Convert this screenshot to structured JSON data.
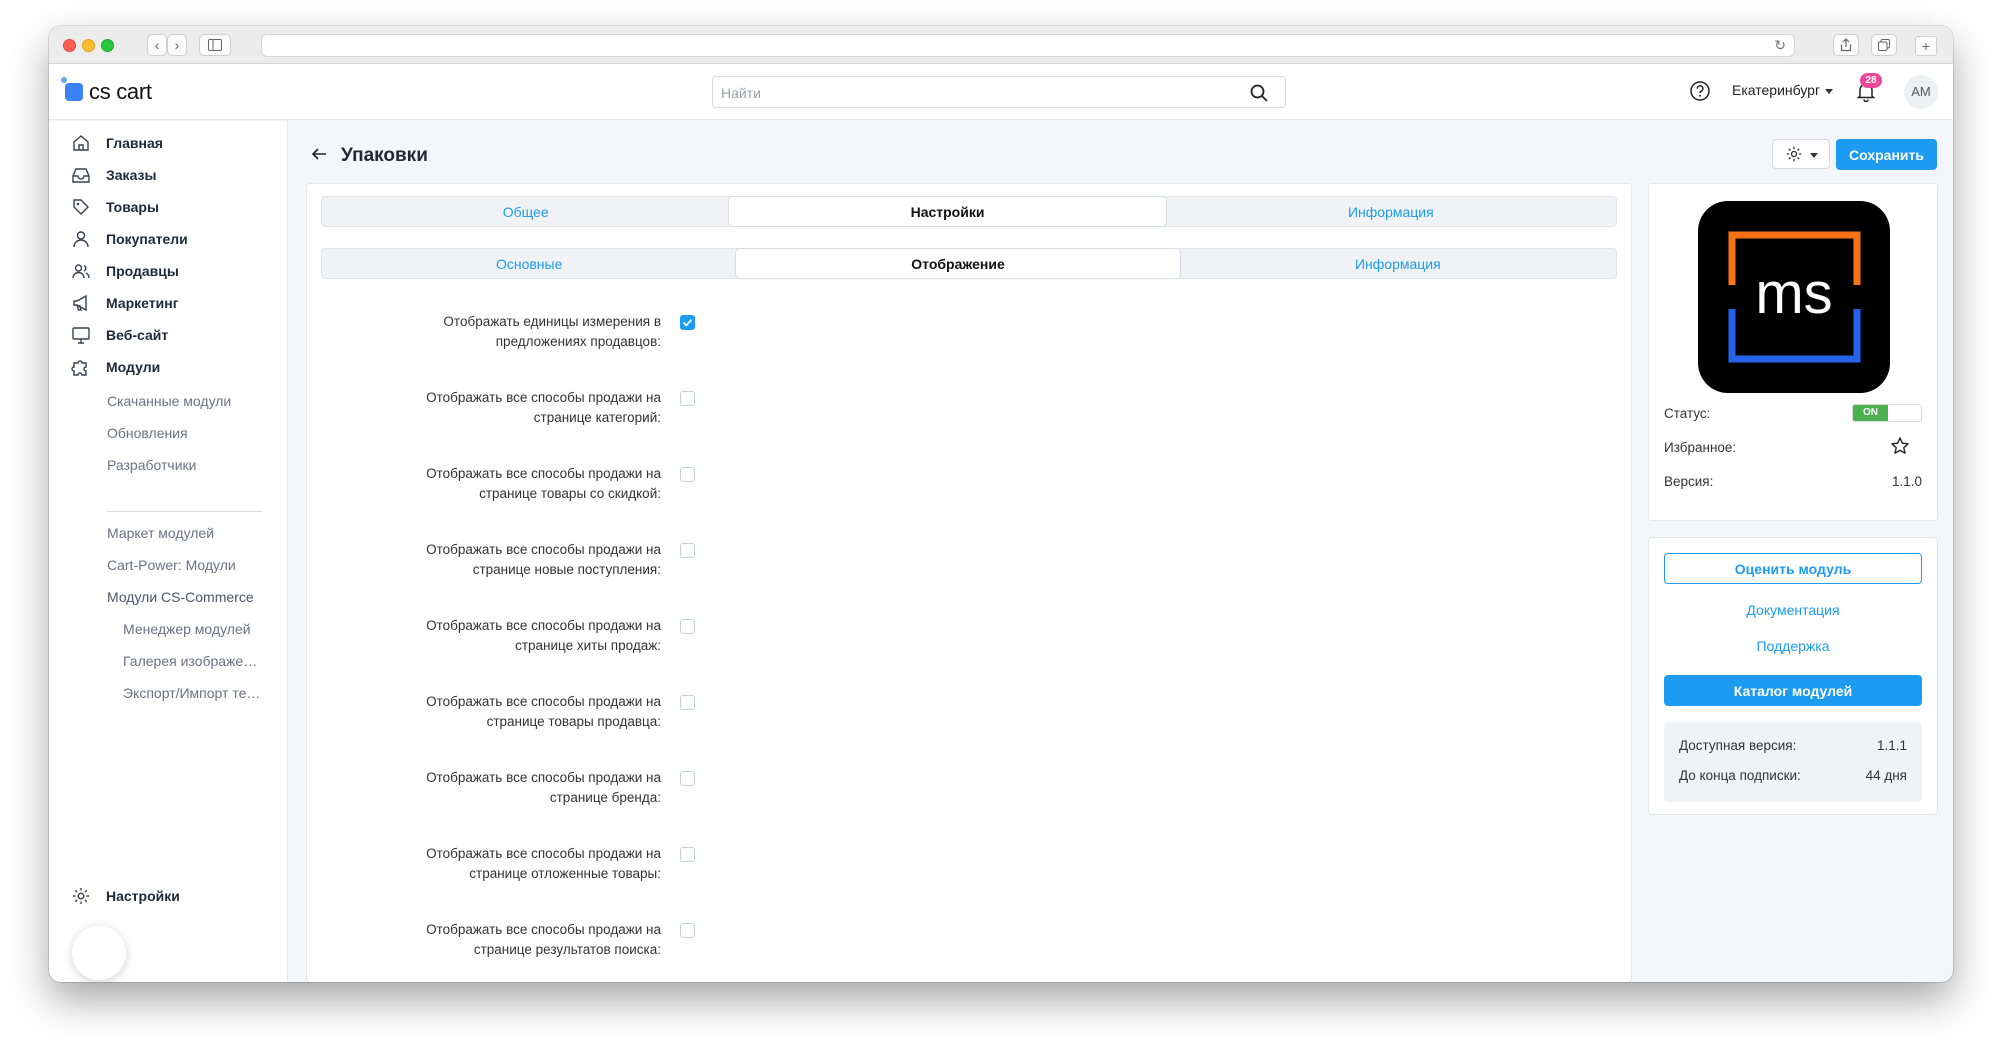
{
  "header": {
    "brand": "cs cart",
    "search_placeholder": "Найти",
    "city": "Екатеринбург",
    "notifications_count": "28",
    "avatar_initials": "AM"
  },
  "sidebar": {
    "items": [
      {
        "label": "Главная",
        "icon": "home-icon"
      },
      {
        "label": "Заказы",
        "icon": "inbox-icon"
      },
      {
        "label": "Товары",
        "icon": "tag-icon"
      },
      {
        "label": "Покупатели",
        "icon": "user-icon"
      },
      {
        "label": "Продавцы",
        "icon": "users-icon"
      },
      {
        "label": "Маркетинг",
        "icon": "megaphone-icon"
      },
      {
        "label": "Веб-сайт",
        "icon": "monitor-icon"
      },
      {
        "label": "Модули",
        "icon": "puzzle-icon"
      }
    ],
    "modules_sub": [
      "Скачанные модули",
      "Обновления",
      "Разработчики"
    ],
    "market_sub": [
      "Маркет модулей",
      "Cart-Power: Модули",
      "Модули CS-Commerce"
    ],
    "cscommerce_sub": [
      "Менеджер модулей",
      "Галерея изображени...",
      "Экспорт/Импорт тего..."
    ],
    "settings_label": "Настройки"
  },
  "page": {
    "title": "Упаковки",
    "save_label": "Сохранить"
  },
  "tabs_primary": [
    {
      "label": "Общее",
      "active": false
    },
    {
      "label": "Настройки",
      "active": true
    },
    {
      "label": "Информация",
      "active": false
    }
  ],
  "tabs_secondary": [
    {
      "label": "Основные",
      "active": false
    },
    {
      "label": "Отображение",
      "active": true
    },
    {
      "label": "Информация",
      "active": false
    }
  ],
  "settings": [
    {
      "line1": "Отображать единицы измерения в",
      "line2": "предложениях продавцов:",
      "checked": true
    },
    {
      "line1": "Отображать все способы продажи на",
      "line2": "странице категорий:",
      "checked": false
    },
    {
      "line1": "Отображать все способы продажи на",
      "line2": "странице товары со скидкой:",
      "checked": false
    },
    {
      "line1": "Отображать все способы продажи на",
      "line2": "странице новые поступления:",
      "checked": false
    },
    {
      "line1": "Отображать все способы продажи на",
      "line2": "странице хиты продаж:",
      "checked": false
    },
    {
      "line1": "Отображать все способы продажи на",
      "line2": "странице товары продавца:",
      "checked": false
    },
    {
      "line1": "Отображать все способы продажи на",
      "line2": "странице бренда:",
      "checked": false
    },
    {
      "line1": "Отображать все способы продажи на",
      "line2": "странице отложенные товары:",
      "checked": false
    },
    {
      "line1": "Отображать все способы продажи на",
      "line2": "странице результатов поиска:",
      "checked": false
    }
  ],
  "module": {
    "logo_text": "ms",
    "status_label": "Статус:",
    "status_value": "ON",
    "favorite_label": "Избранное:",
    "version_label": "Версия:",
    "version_value": "1.1.0",
    "rate_label": "Оценить модуль",
    "docs_label": "Документация",
    "support_label": "Поддержка",
    "catalog_label": "Каталог модулей",
    "available_label": "Доступная версия:",
    "available_value": "1.1.1",
    "subscription_label": "До конца подписки:",
    "subscription_value": "44 дня"
  },
  "colors": {
    "accent": "#1d9bf0",
    "status_on": "#4caf50",
    "badge": "#ec4899",
    "logo_orange": "#f97316",
    "logo_blue": "#2563eb"
  }
}
